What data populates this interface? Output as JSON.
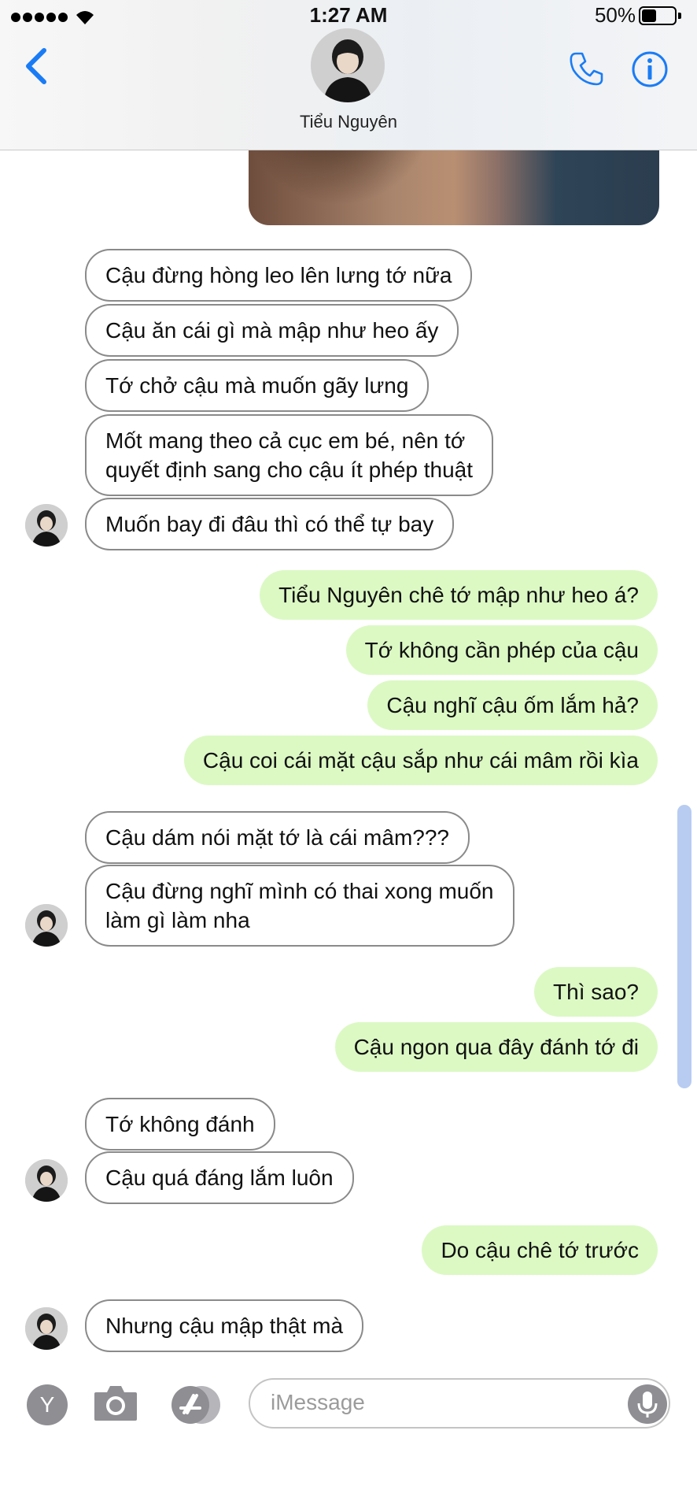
{
  "status_bar": {
    "time": "1:27 AM",
    "battery": "50%",
    "battery_level": 0.5
  },
  "header": {
    "contact_name": "Tiểu Nguyên"
  },
  "messages": [
    {
      "side": "in",
      "text": "Cậu đừng hòng leo lên lưng tớ nữa"
    },
    {
      "side": "in",
      "text": "Cậu ăn cái gì mà mập như heo ấy"
    },
    {
      "side": "in",
      "text": "Tớ chở cậu mà muốn gãy lưng"
    },
    {
      "side": "in",
      "line1": "Mốt mang theo cả cục em bé, nên tớ",
      "line2": "quyết định sang cho cậu ít phép thuật"
    },
    {
      "side": "in",
      "text": "Muốn bay đi đâu thì có thể tự bay"
    },
    {
      "side": "out",
      "text": "Tiểu Nguyên chê tớ mập như heo á?"
    },
    {
      "side": "out",
      "text": "Tớ không cần phép của cậu"
    },
    {
      "side": "out",
      "text": "Cậu nghĩ cậu ốm lắm hả?"
    },
    {
      "side": "out",
      "text": "Cậu coi cái mặt cậu sắp như cái mâm rồi kìa"
    },
    {
      "side": "in",
      "text": "Cậu dám nói mặt tớ là cái mâm???"
    },
    {
      "side": "in",
      "line1": "Cậu đừng nghĩ mình có thai xong muốn",
      "line2": "làm gì làm nha"
    },
    {
      "side": "out",
      "text": "Thì sao?"
    },
    {
      "side": "out",
      "text": "Cậu ngon qua đây đánh tớ đi"
    },
    {
      "side": "in",
      "text": "Tớ không đánh"
    },
    {
      "side": "in",
      "text": "Cậu quá đáng lắm luôn"
    },
    {
      "side": "out",
      "text": "Do cậu chê tớ trước"
    },
    {
      "side": "in",
      "text": "Nhưng cậu mập thật mà"
    }
  ],
  "input_bar": {
    "y_label": "Y",
    "placeholder": "iMessage"
  },
  "colors": {
    "accent": "#1a7cf5",
    "outgoing_bubble": "#dcf9c4",
    "incoming_border": "#8a8a8a"
  },
  "icons": [
    "chevron-left-icon",
    "phone-icon",
    "info-icon",
    "camera-icon",
    "app-store-icon",
    "microphone-icon",
    "wifi-icon",
    "battery-icon"
  ]
}
